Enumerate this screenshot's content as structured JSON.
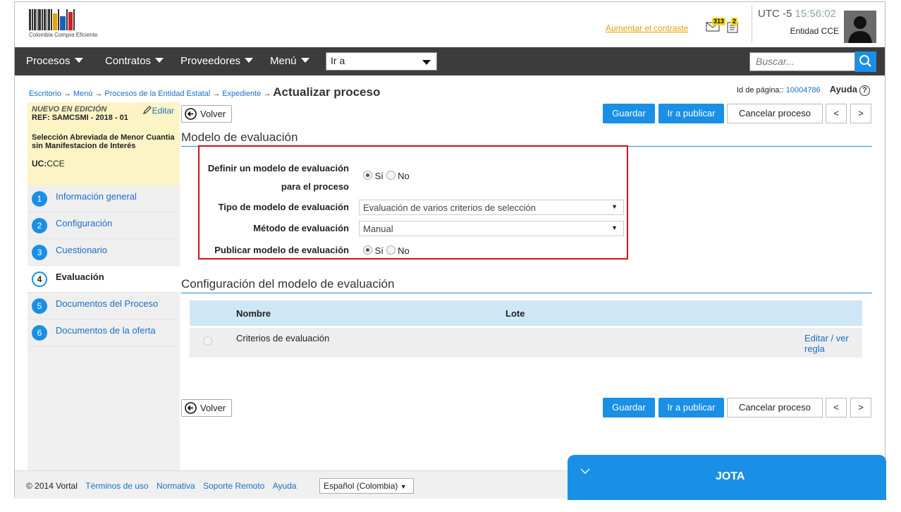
{
  "header": {
    "logo_text": "Colombia Compra Eficiente",
    "contrast_link": "Aumentar el contraste",
    "mail_count": "313",
    "notif_count": "2",
    "timezone": "UTC -5",
    "time": "15:56:02",
    "entity": "Entidad CCE"
  },
  "nav": {
    "items": [
      "Procesos",
      "Contratos",
      "Proveedores",
      "Menú"
    ],
    "goto_value": "Ir a",
    "search_placeholder": "Buscar..."
  },
  "breadcrumb": {
    "items": [
      "Escritorio",
      "Menú",
      "Procesos de la Entidad Estatal",
      "Expediente"
    ],
    "current": "Actualizar proceso",
    "page_id_label": "Id de página::",
    "page_id": "10004786",
    "help": "Ayuda"
  },
  "sidebar": {
    "status": "NUEVO EN EDICIÓN",
    "edit": "Editar",
    "ref": "REF: SAMCSMI - 2018 - 01",
    "modality": "Selección Abreviada de Menor Cuantia sin Manifestacion de Interés",
    "uc_label": "UC:",
    "uc_value": "CCE",
    "steps": [
      {
        "num": "1",
        "label": "Información general"
      },
      {
        "num": "2",
        "label": "Configuración"
      },
      {
        "num": "3",
        "label": "Cuestionario"
      },
      {
        "num": "4",
        "label": "Evaluación"
      },
      {
        "num": "5",
        "label": "Documentos del Proceso"
      },
      {
        "num": "6",
        "label": "Documentos de la oferta"
      }
    ]
  },
  "buttons": {
    "back": "Volver",
    "save": "Guardar",
    "publish": "Ir a publicar",
    "cancel": "Cancelar proceso",
    "prev": "<",
    "next": ">"
  },
  "evaluation": {
    "title": "Modelo de evaluación",
    "define_label_1": "Definir un modelo de evaluación",
    "define_label_2": "para el proceso",
    "yes": "Sí",
    "no": "No",
    "type_label": "Tipo de modelo de evaluación",
    "type_value": "Evaluación de varios criterios de selección",
    "method_label": "Método de evaluación",
    "method_value": "Manual",
    "publish_label": "Publicar modelo de evaluación"
  },
  "config": {
    "title": "Configuración del modelo de evaluación",
    "col_name": "Nombre",
    "col_lot": "Lote",
    "row_name": "Criterios de evaluación",
    "row_action": "Editar / ver regla"
  },
  "footer": {
    "copyright": "© 2014 Vortal",
    "links": [
      "Términos de uso",
      "Normativa",
      "Soporte Remoto",
      "Ayuda"
    ],
    "language": "Español (Colombia)"
  },
  "chat": {
    "title": "JOTA"
  },
  "colors": {
    "accent": "#1a8fe6",
    "nav": "#3c3c3c",
    "highlight_border": "#d60f1c",
    "sidebar_info": "#fcf4c4"
  }
}
